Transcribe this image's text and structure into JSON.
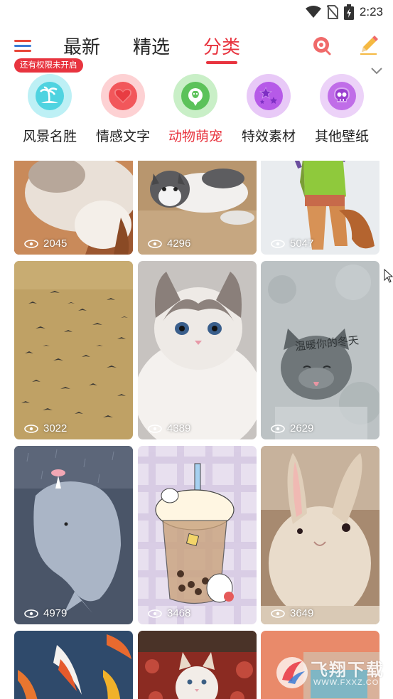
{
  "status_bar": {
    "time": "2:23",
    "icons": [
      "wifi-icon",
      "no-sim-icon",
      "battery-charging-icon"
    ]
  },
  "nav": {
    "permission_badge": "还有权限未开启",
    "tabs": [
      {
        "label": "最新",
        "active": false
      },
      {
        "label": "精选",
        "active": false
      },
      {
        "label": "分类",
        "active": true
      }
    ],
    "accent_color": "#e8343f"
  },
  "categories": [
    {
      "label": "风景名胜",
      "icon": "palm-island-icon",
      "color": "#4fd3e0",
      "ring": "#bdf0f5",
      "active": false
    },
    {
      "label": "情感文字",
      "icon": "heart-icon",
      "color": "#f2575b",
      "ring": "#fdd1d3",
      "active": false
    },
    {
      "label": "动物萌宠",
      "icon": "pet-dog-icon",
      "color": "#5cc25a",
      "ring": "#c9efc7",
      "active": true
    },
    {
      "label": "特效素材",
      "icon": "stars-icon",
      "color": "#b65ae8",
      "ring": "#e8c9f7",
      "active": false
    },
    {
      "label": "其他壁纸",
      "icon": "skull-icon",
      "color": "#c06de8",
      "ring": "#ecd2f8",
      "active": false
    }
  ],
  "wallpapers": [
    {
      "views": "2045",
      "subject": "white cat paw"
    },
    {
      "views": "4296",
      "subject": "grey white cat lying"
    },
    {
      "views": "5047",
      "subject": "cartoon fox legs"
    },
    {
      "views": "3022",
      "subject": "flock of birds"
    },
    {
      "views": "4389",
      "subject": "ragdoll cat"
    },
    {
      "views": "2629",
      "subject": "grey cat on window",
      "caption": "温暖你的冬天"
    },
    {
      "views": "4979",
      "subject": "cartoon whale"
    },
    {
      "views": "3468",
      "subject": "bubble tea bunny"
    },
    {
      "views": "3649",
      "subject": "fluffy rabbit"
    },
    {
      "subject": "koi fish"
    },
    {
      "subject": "kitten on red couch"
    },
    {
      "subject": "orange wall"
    }
  ],
  "watermark": {
    "title": "飞翔下载",
    "url": "WWW.FXXZ.COM"
  }
}
